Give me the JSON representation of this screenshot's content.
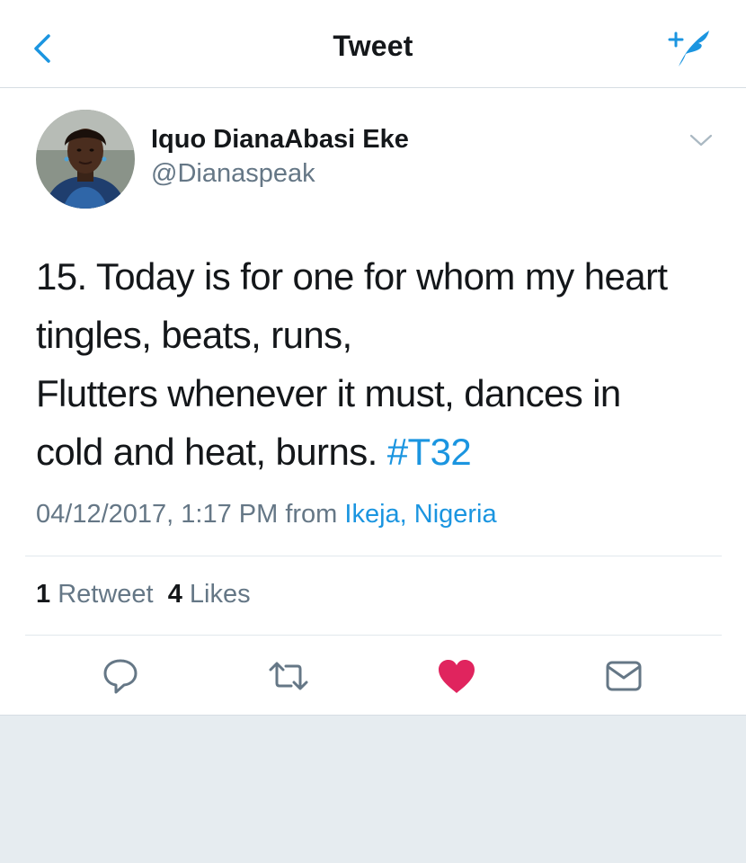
{
  "nav": {
    "title": "Tweet",
    "back_icon": "chevron-left-icon",
    "compose_icon": "compose-tweet-icon"
  },
  "author": {
    "name": "Iquo DianaAbasi Eke",
    "handle": "@Dianaspeak"
  },
  "tweet": {
    "lines": [
      "15. Today is for one for whom my heart",
      "tingles, beats, runs,",
      "Flutters whenever it must, dances in",
      "cold and heat, burns."
    ],
    "hashtag": "#T32",
    "timestamp": "04/12/2017, 1:17 PM",
    "from_label": "from",
    "location": "Ikeja, Nigeria"
  },
  "stats": {
    "retweets_count": "1",
    "retweets_label": "Retweet",
    "likes_count": "4",
    "likes_label": "Likes"
  },
  "actions": {
    "reply_icon": "reply-icon",
    "retweet_icon": "retweet-icon",
    "like_icon": "heart-icon",
    "dm_icon": "envelope-icon"
  },
  "colors": {
    "accent": "#1b95e0",
    "like": "#e0245e",
    "secondary_text": "#657786",
    "background": "#e6ecf0"
  }
}
